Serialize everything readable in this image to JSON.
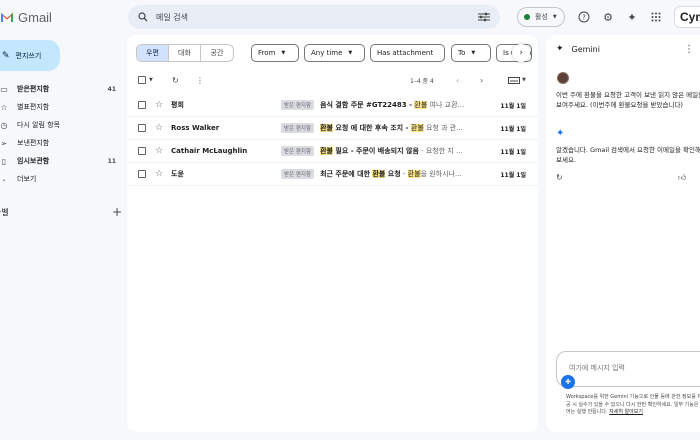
{
  "app": {
    "name": "Gmail"
  },
  "search": {
    "placeholder": "메일 검색"
  },
  "status": {
    "label": "활성",
    "color": "#188038"
  },
  "brand": {
    "text": "Cym"
  },
  "compose": {
    "label": "편지쓰기"
  },
  "nav": [
    {
      "label": "받은편지함",
      "count": "41",
      "icon": "inbox-icon",
      "bold": true
    },
    {
      "label": "별표편지함",
      "count": "",
      "icon": "star-icon",
      "bold": false
    },
    {
      "label": "다시 알림 항목",
      "count": "",
      "icon": "clock-icon",
      "bold": false
    },
    {
      "label": "보낸편지함",
      "count": "",
      "icon": "send-icon",
      "bold": false
    },
    {
      "label": "임시보관함",
      "count": "11",
      "icon": "draft-icon",
      "bold": true
    },
    {
      "label": "더보기",
      "count": "",
      "icon": "chevron-down-icon",
      "bold": false
    }
  ],
  "labels": {
    "title": "라벨"
  },
  "tabs": [
    {
      "label": "우편",
      "active": true
    },
    {
      "label": "대화",
      "active": false
    },
    {
      "label": "공간",
      "active": false
    }
  ],
  "filters": [
    {
      "label": "From"
    },
    {
      "label": "Any time"
    },
    {
      "label": "Has attachment"
    },
    {
      "label": "To"
    },
    {
      "label": "Is unread"
    }
  ],
  "toolbar": {
    "range": "1–4 중 4"
  },
  "emails": [
    {
      "sender": "평희",
      "tag": "받은 편지함",
      "subject_pre": "음식 결함 주문 #GT22483 - ",
      "highlight": "환불",
      "snippet": " 여나 교환...",
      "date": "11월 1일"
    },
    {
      "sender": "Ross Walker",
      "tag": "받은 편지함",
      "subject_hl": "환불",
      "subject_post": " 요청 에 대한 후속 조치 - ",
      "highlight": "환불",
      "snippet": " 요청 과 관...",
      "date": "11월 1일"
    },
    {
      "sender": "Cathair McLaughlin",
      "tag": "받은 편지함",
      "subject_hl": "환불",
      "subject_post": " 필요 - 주문이 배송되지 않음",
      "snippet": " - 요청한 지 ...",
      "date": "11월 1일"
    },
    {
      "sender": "도윤",
      "tag": "받은 편지함",
      "subject_pre": "최근 주문에 대한 ",
      "subject_hl": "환불",
      "subject_post": " 요청",
      "snippet_hl": "환불",
      "snippet": "을 원하시나...",
      "date": "11월 1일"
    }
  ],
  "gemini": {
    "title": "Gemini",
    "user_message": "이번 주에 환불을 요청한 고객이 보낸 읽지 않은 메일을 보여주세요. (이번주에 환불요청을 받았습니다)",
    "response": "알겠습니다. Gmail 검색에서 요청한 이메일을 확인해 보세요.",
    "input_placeholder": "여기에 메시지 입력",
    "disclaimer": "Workspace를 위한 Gemini 기능으로 인물 등에 관한 정보를 제공 시 실수가 있을 수 있으니 다시 한번 확인하세요. 일부 기능은 언어는 실행 안됩니다.",
    "disclaimer_link": "자세히 알아보기"
  }
}
